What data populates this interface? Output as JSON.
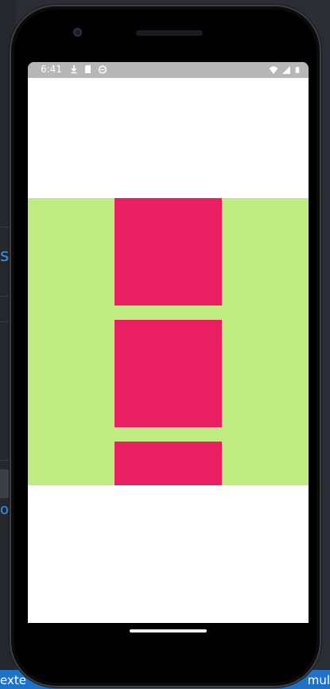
{
  "ide": {
    "left_fragment_top": "s",
    "left_fragment_bottom": "o",
    "status_left_text": "exte",
    "status_right_text": "mul",
    "status_color": "#1e73c8"
  },
  "device": {
    "status_bar": {
      "time": "6:41",
      "notification_icons": [
        "download-icon",
        "sd-card-icon",
        "android-icon"
      ],
      "system_icons": [
        "wifi-icon",
        "cell-signal-icon",
        "battery-icon"
      ]
    }
  },
  "app": {
    "background_color": "#ffffff",
    "band_color": "#bfec80",
    "box_color": "#e91e63",
    "boxes": [
      {
        "name": "box-1"
      },
      {
        "name": "box-2"
      },
      {
        "name": "box-3"
      }
    ]
  }
}
